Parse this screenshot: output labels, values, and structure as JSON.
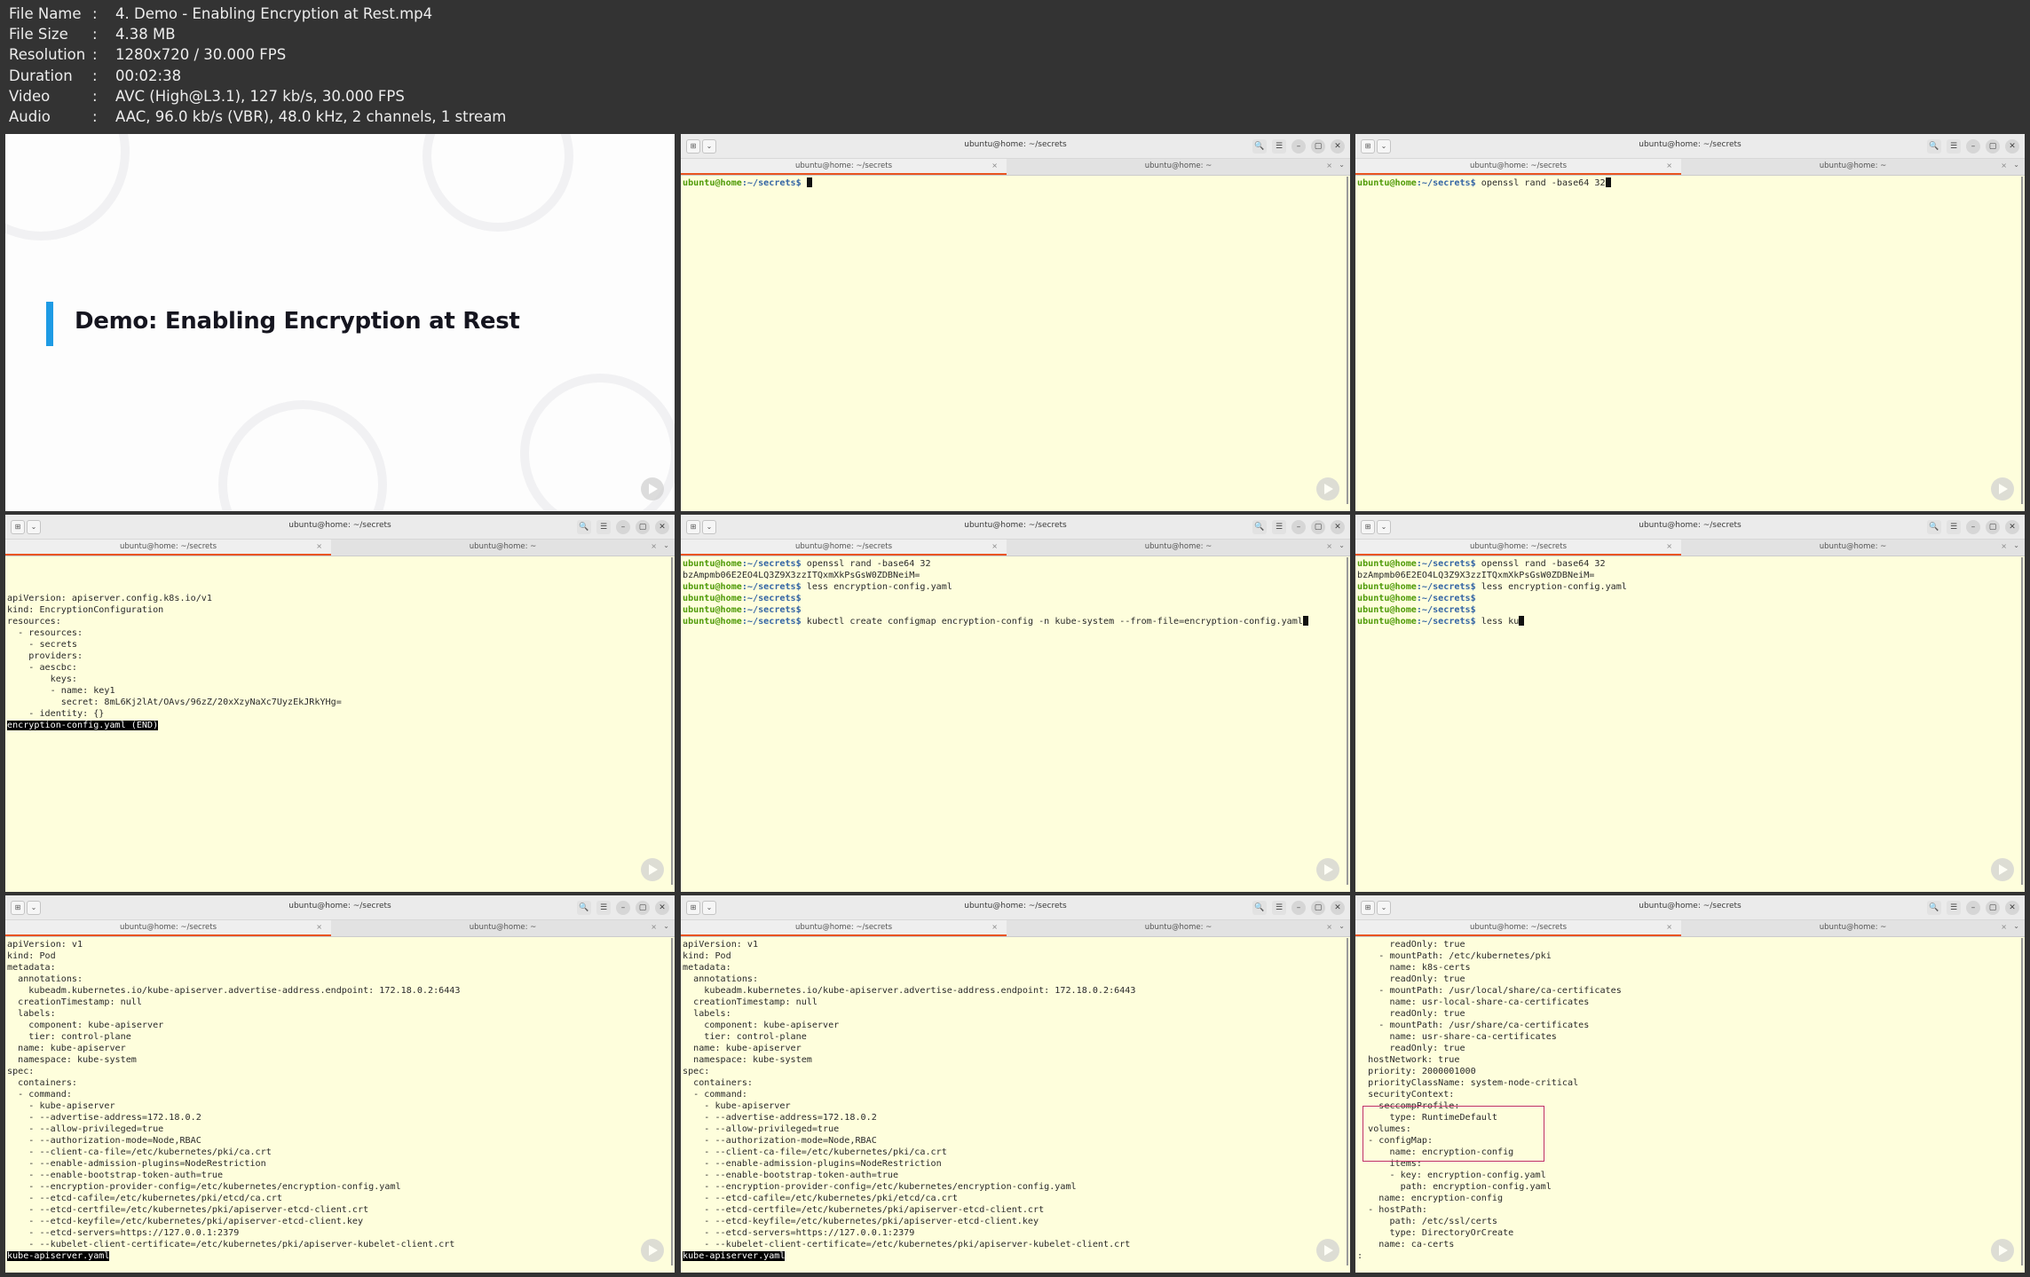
{
  "info": [
    {
      "key": "File Name",
      "value": "4. Demo - Enabling Encryption at Rest.mp4"
    },
    {
      "key": "File Size",
      "value": "4.38 MB"
    },
    {
      "key": "Resolution",
      "value": "1280x720 / 30.000 FPS"
    },
    {
      "key": "Duration",
      "value": "00:02:38"
    },
    {
      "key": "Video",
      "value": "AVC (High@L3.1), 127 kb/s, 30.000 FPS"
    },
    {
      "key": "Audio",
      "value": "AAC, 96.0 kb/s (VBR), 48.0 kHz, 2 channels, 1 stream"
    }
  ],
  "info_separator": ":",
  "slide": {
    "title": "Demo: Enabling Encryption at Rest"
  },
  "window": {
    "title": "ubuntu@home: ~/secrets",
    "tab1": "ubuntu@home: ~/secrets",
    "tab2": "ubuntu@home: ~",
    "icons": {
      "new_tab": "⊞",
      "dropdown": "⌄",
      "search": "🔍",
      "menu": "☰",
      "minimize": "–",
      "maximize": "▢",
      "close": "✕",
      "tab_close": "×"
    }
  },
  "prompt_user": "ubuntu@home",
  "prompt_path": ":~/secrets$ ",
  "terminals": [
    {
      "lines": [
        {
          "prompt": true,
          "text": "",
          "cursor": true
        }
      ]
    },
    {
      "lines": [
        {
          "prompt": true,
          "text": "openssl rand -base64 32",
          "cursor": true
        }
      ]
    },
    {
      "lines": [
        {
          "text": ""
        },
        {
          "text": ""
        },
        {
          "text": ""
        },
        {
          "text": "apiVersion: apiserver.config.k8s.io/v1"
        },
        {
          "text": "kind: EncryptionConfiguration"
        },
        {
          "text": "resources:"
        },
        {
          "text": "  - resources:"
        },
        {
          "text": "    - secrets"
        },
        {
          "text": "    providers:"
        },
        {
          "text": "    - aescbc:"
        },
        {
          "text": "        keys:"
        },
        {
          "text": "        - name: key1"
        },
        {
          "text": "          secret: 8mL6Kj2lAt/OAvs/96zZ/20xXzyNaXc7UyzEkJRkYHg="
        },
        {
          "text": "    - identity: {}"
        },
        {
          "text": "encryption-config.yaml (END)",
          "highlight": true
        }
      ]
    },
    {
      "lines": [
        {
          "prompt": true,
          "text": "openssl rand -base64 32"
        },
        {
          "text": "bzAmpmb06E2EO4LQ3Z9X3zzITQxmXkPsGsW0ZDBNeiM="
        },
        {
          "prompt": true,
          "text": "less encryption-config.yaml"
        },
        {
          "prompt": true,
          "text": ""
        },
        {
          "prompt": true,
          "text": ""
        },
        {
          "prompt": true,
          "text": "kubectl create configmap encryption-config -n kube-system --from-file=encryption-config.yaml",
          "cursor": true
        }
      ]
    },
    {
      "lines": [
        {
          "prompt": true,
          "text": "openssl rand -base64 32"
        },
        {
          "text": "bzAmpmb06E2EO4LQ3Z9X3zzITQxmXkPsGsW0ZDBNeiM="
        },
        {
          "prompt": true,
          "text": "less encryption-config.yaml"
        },
        {
          "prompt": true,
          "text": ""
        },
        {
          "prompt": true,
          "text": ""
        },
        {
          "prompt": true,
          "text": "less ku",
          "cursor": true
        }
      ]
    },
    {
      "lines": [
        {
          "text": "apiVersion: v1"
        },
        {
          "text": "kind: Pod"
        },
        {
          "text": "metadata:"
        },
        {
          "text": "  annotations:"
        },
        {
          "text": "    kubeadm.kubernetes.io/kube-apiserver.advertise-address.endpoint: 172.18.0.2:6443"
        },
        {
          "text": "  creationTimestamp: null"
        },
        {
          "text": "  labels:"
        },
        {
          "text": "    component: kube-apiserver"
        },
        {
          "text": "    tier: control-plane"
        },
        {
          "text": "  name: kube-apiserver"
        },
        {
          "text": "  namespace: kube-system"
        },
        {
          "text": "spec:"
        },
        {
          "text": "  containers:"
        },
        {
          "text": "  - command:"
        },
        {
          "text": "    - kube-apiserver"
        },
        {
          "text": "    - --advertise-address=172.18.0.2"
        },
        {
          "text": "    - --allow-privileged=true"
        },
        {
          "text": "    - --authorization-mode=Node,RBAC"
        },
        {
          "text": "    - --client-ca-file=/etc/kubernetes/pki/ca.crt"
        },
        {
          "text": "    - --enable-admission-plugins=NodeRestriction"
        },
        {
          "text": "    - --enable-bootstrap-token-auth=true"
        },
        {
          "text": "    - --encryption-provider-config=/etc/kubernetes/encryption-config.yaml"
        },
        {
          "text": "    - --etcd-cafile=/etc/kubernetes/pki/etcd/ca.crt"
        },
        {
          "text": "    - --etcd-certfile=/etc/kubernetes/pki/apiserver-etcd-client.crt"
        },
        {
          "text": "    - --etcd-keyfile=/etc/kubernetes/pki/apiserver-etcd-client.key"
        },
        {
          "text": "    - --etcd-servers=https://127.0.0.1:2379"
        },
        {
          "text": "    - --kubelet-client-certificate=/etc/kubernetes/pki/apiserver-kubelet-client.crt"
        },
        {
          "text": "kube-apiserver.yaml",
          "highlight": true
        }
      ]
    },
    {
      "lines": [
        {
          "text": "apiVersion: v1"
        },
        {
          "text": "kind: Pod"
        },
        {
          "text": "metadata:"
        },
        {
          "text": "  annotations:"
        },
        {
          "text": "    kubeadm.kubernetes.io/kube-apiserver.advertise-address.endpoint: 172.18.0.2:6443"
        },
        {
          "text": "  creationTimestamp: null"
        },
        {
          "text": "  labels:"
        },
        {
          "text": "    component: kube-apiserver"
        },
        {
          "text": "    tier: control-plane"
        },
        {
          "text": "  name: kube-apiserver"
        },
        {
          "text": "  namespace: kube-system"
        },
        {
          "text": "spec:"
        },
        {
          "text": "  containers:"
        },
        {
          "text": "  - command:"
        },
        {
          "text": "    - kube-apiserver"
        },
        {
          "text": "    - --advertise-address=172.18.0.2"
        },
        {
          "text": "    - --allow-privileged=true"
        },
        {
          "text": "    - --authorization-mode=Node,RBAC"
        },
        {
          "text": "    - --client-ca-file=/etc/kubernetes/pki/ca.crt"
        },
        {
          "text": "    - --enable-admission-plugins=NodeRestriction"
        },
        {
          "text": "    - --enable-bootstrap-token-auth=true"
        },
        {
          "text": "    - --encryption-provider-config=/etc/kubernetes/encryption-config.yaml"
        },
        {
          "text": "    - --etcd-cafile=/etc/kubernetes/pki/etcd/ca.crt"
        },
        {
          "text": "    - --etcd-certfile=/etc/kubernetes/pki/apiserver-etcd-client.crt"
        },
        {
          "text": "    - --etcd-keyfile=/etc/kubernetes/pki/apiserver-etcd-client.key"
        },
        {
          "text": "    - --etcd-servers=https://127.0.0.1:2379"
        },
        {
          "text": "    - --kubelet-client-certificate=/etc/kubernetes/pki/apiserver-kubelet-client.crt"
        },
        {
          "text": "kube-apiserver.yaml",
          "highlight": true
        }
      ]
    },
    {
      "lines": [
        {
          "text": "      readOnly: true"
        },
        {
          "text": "    - mountPath: /etc/kubernetes/pki"
        },
        {
          "text": "      name: k8s-certs"
        },
        {
          "text": "      readOnly: true"
        },
        {
          "text": "    - mountPath: /usr/local/share/ca-certificates"
        },
        {
          "text": "      name: usr-local-share-ca-certificates"
        },
        {
          "text": "      readOnly: true"
        },
        {
          "text": "    - mountPath: /usr/share/ca-certificates"
        },
        {
          "text": "      name: usr-share-ca-certificates"
        },
        {
          "text": "      readOnly: true"
        },
        {
          "text": "  hostNetwork: true"
        },
        {
          "text": "  priority: 2000001000"
        },
        {
          "text": "  priorityClassName: system-node-critical"
        },
        {
          "text": "  securityContext:"
        },
        {
          "text": "    seccompProfile:"
        },
        {
          "text": "      type: RuntimeDefault"
        },
        {
          "text": "  volumes:"
        },
        {
          "text": "  - configMap:"
        },
        {
          "text": "      name: encryption-config"
        },
        {
          "text": "      items:"
        },
        {
          "text": "      - key: encryption-config.yaml"
        },
        {
          "text": "        path: encryption-config.yaml"
        },
        {
          "text": "    name: encryption-config"
        },
        {
          "text": "  - hostPath:"
        },
        {
          "text": "      path: /etc/ssl/certs"
        },
        {
          "text": "      type: DirectoryOrCreate"
        },
        {
          "text": "    name: ca-certs"
        },
        {
          "text": ":"
        }
      ]
    }
  ]
}
